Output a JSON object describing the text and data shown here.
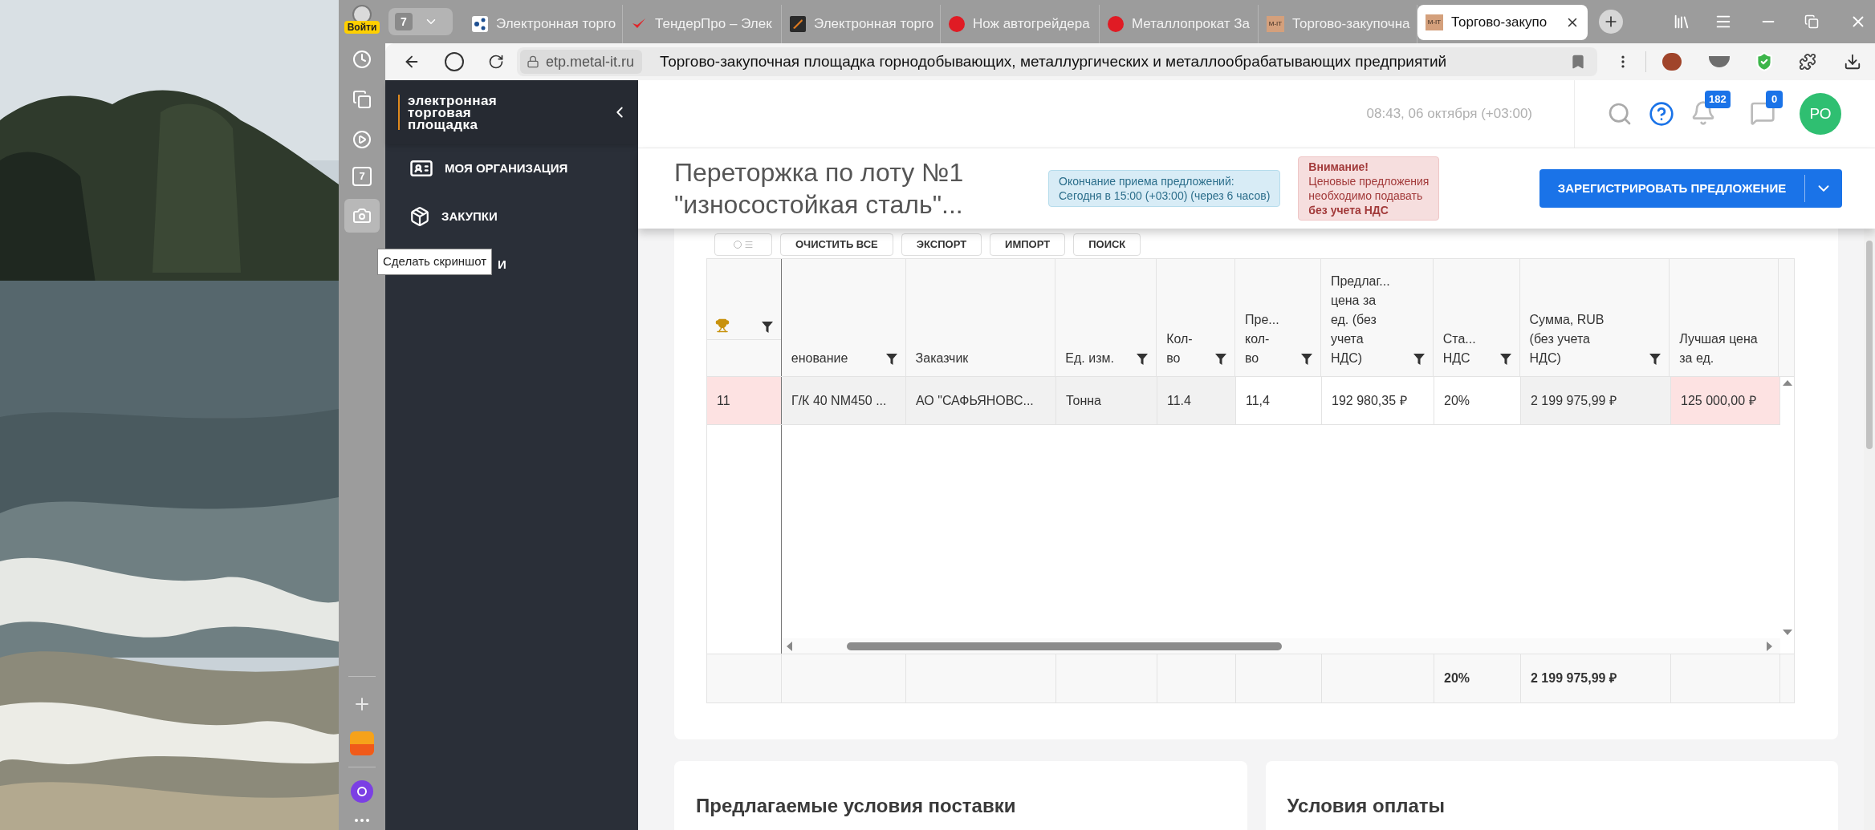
{
  "browser": {
    "sidebar": {
      "login_badge": "Войти",
      "counter": "7",
      "tooltip": "Сделать скриншот"
    },
    "tab_counter": "7",
    "tabs": [
      {
        "title": "Электронная торго",
        "kind": "network",
        "selected": false
      },
      {
        "title": "ТендерПро – Элек",
        "kind": "check",
        "selected": false
      },
      {
        "title": "Электронная торго",
        "kind": "square",
        "selected": false
      },
      {
        "title": "Нож автогрейдера",
        "kind": "dot",
        "selected": false
      },
      {
        "title": "Металлопрокат За",
        "kind": "dot",
        "selected": false
      },
      {
        "title": "Торгово-закупочна",
        "kind": "lettered",
        "favicon_text": "M-IT",
        "selected": false
      },
      {
        "title": "Торгово-закупо",
        "kind": "lettered",
        "favicon_text": "M-IT",
        "selected": true
      }
    ],
    "address": {
      "domain": "etp.metal-it.ru",
      "page_title": "Торгово-закупочная площадка горнодобывающих, металлургических и металлообрабатывающих предприятий"
    }
  },
  "site": {
    "logo_lines": [
      "электронная",
      "торговая",
      "площадка"
    ],
    "nav": [
      {
        "label": "МОЯ ОРГАНИЗАЦИЯ",
        "kind": "item"
      },
      {
        "label": "ЗАКУПКИ",
        "kind": "item"
      },
      {
        "label": "И",
        "kind": "covered"
      }
    ],
    "header": {
      "time": "08:43, 06 октября (+03:00)",
      "notifications": "182",
      "messages": "0",
      "avatar": "РО"
    },
    "lot": {
      "title_lines": [
        "Переторжка по лоту №1",
        "\"износостойкая сталь\"..."
      ],
      "deadline_lines": [
        "Окончание приема предложений:",
        "Сегодня в 15:00 (+03:00) (через 6 часов)"
      ],
      "warning_lines": [
        "**Внимание!**",
        "Ценовые предложения",
        "необходимо подавать",
        "**без учета НДС**"
      ],
      "register_button": "ЗАРЕГИСТРИРОВАТЬ ПРЕДЛОЖЕНИЕ"
    },
    "toolbar": [
      {
        "kind": "icon"
      },
      {
        "kind": "text",
        "label": "ОЧИСТИТЬ ВСЕ"
      },
      {
        "kind": "text",
        "label": "ЭКСПОРТ"
      },
      {
        "kind": "text",
        "label": "ИМПОРТ"
      },
      {
        "kind": "text",
        "label": "ПОИСК"
      }
    ],
    "table": {
      "columns": [
        {
          "lines": [
            "енование"
          ],
          "filter": true
        },
        {
          "lines": [
            "Заказчик"
          ],
          "filter": false
        },
        {
          "lines": [
            "Ед. изм."
          ],
          "filter": true
        },
        {
          "lines": [
            "Кол-",
            "во"
          ],
          "filter": true
        },
        {
          "lines": [
            "Пре...",
            "кол-",
            "во"
          ],
          "filter": true
        },
        {
          "lines": [
            "Предлаг...",
            "цена за",
            "ед. (без",
            "учета",
            "НДС)"
          ],
          "filter": true
        },
        {
          "lines": [
            "Ста...",
            "НДС"
          ],
          "filter": true
        },
        {
          "lines": [
            "Сумма, RUB",
            "(без учета",
            "НДС)"
          ],
          "filter": true
        },
        {
          "lines": [
            "Лучшая цена",
            "за ед."
          ],
          "filter": false
        }
      ],
      "rows": [
        {
          "index": {
            "text": "11",
            "kind": "highlight"
          },
          "cells": [
            {
              "text": "Г/К 40 NM450 ...",
              "kind": "readonly"
            },
            {
              "text": "АО \"САФЬЯНОВС...",
              "kind": "readonly"
            },
            {
              "text": "Тонна",
              "kind": "readonly"
            },
            {
              "text": "11.4",
              "kind": "readonly"
            },
            {
              "text": "11,4",
              "kind": "editable"
            },
            {
              "text": "192 980,35 ₽",
              "kind": "editable"
            },
            {
              "text": "20%",
              "kind": "editable"
            },
            {
              "text": "2 199 975,99 ₽",
              "kind": "readonly"
            },
            {
              "text": "125 000,00 ₽",
              "kind": "highlight"
            }
          ]
        }
      ],
      "totals": {
        "vat_rate": "20%",
        "sum": "2 199 975,99 ₽"
      }
    },
    "sections": [
      {
        "title": "Предлагаемые условия поставки"
      },
      {
        "title": "Условия оплаты"
      }
    ]
  }
}
